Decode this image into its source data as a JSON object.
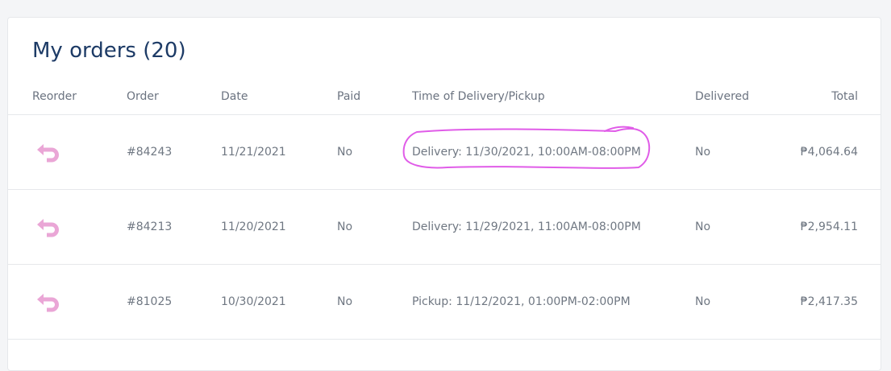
{
  "page": {
    "title": "My orders (20)"
  },
  "table": {
    "headers": {
      "reorder": "Reorder",
      "order": "Order",
      "date": "Date",
      "paid": "Paid",
      "time": "Time of Delivery/Pickup",
      "delivered": "Delivered",
      "total": "Total"
    },
    "rows": [
      {
        "order": "#84243",
        "date": "11/21/2021",
        "paid": "No",
        "time": "Delivery: 11/30/2021, 10:00AM-08:00PM",
        "delivered": "No",
        "total": "₱4,064.64"
      },
      {
        "order": "#84213",
        "date": "11/20/2021",
        "paid": "No",
        "time": "Delivery: 11/29/2021, 11:00AM-08:00PM",
        "delivered": "No",
        "total": "₱2,954.11"
      },
      {
        "order": "#81025",
        "date": "10/30/2021",
        "paid": "No",
        "time": "Pickup: 11/12/2021, 01:00PM-02:00PM",
        "delivered": "No",
        "total": "₱2,417.35"
      }
    ]
  },
  "icons": {
    "reorder": "reorder-arrow-icon"
  },
  "colors": {
    "title": "#1d3b66",
    "text": "#6f7782",
    "reorder_icon": "#eaa6d6",
    "annotation": "#e05ce8",
    "border": "#e6e8eb"
  }
}
